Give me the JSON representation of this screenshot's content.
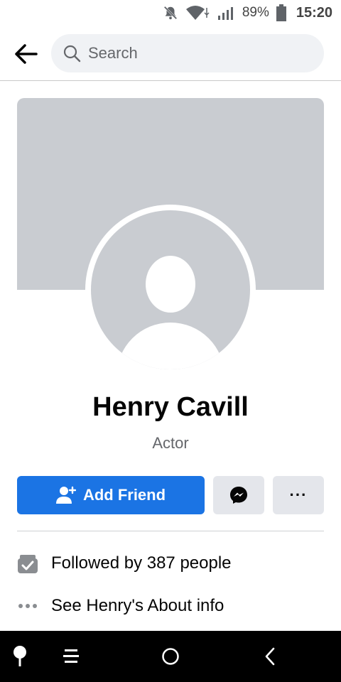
{
  "status_bar": {
    "icons": [
      "bell-muted-icon",
      "wifi-icon",
      "signal-icon",
      "battery-icon"
    ],
    "battery_percent": "89%",
    "time": "15:20"
  },
  "topbar": {
    "back_icon": "arrow-left-icon",
    "search": {
      "placeholder": "Search",
      "value": ""
    }
  },
  "profile": {
    "name": "Henry Cavill",
    "subtitle": "Actor"
  },
  "actions": {
    "add_friend_label": "Add Friend",
    "message_icon": "messenger-icon",
    "more_label": "···"
  },
  "info": [
    {
      "icon": "followers-icon",
      "text": "Followed by 387 people"
    },
    {
      "icon": "more-dots-icon",
      "text": "See Henry's About info"
    }
  ],
  "navbar": {
    "items": [
      "pin-icon",
      "menu-lines-icon",
      "home-circle-icon",
      "back-chevron-icon"
    ]
  },
  "colors": {
    "primary": "#1b74e4",
    "placeholder_gray": "#c9ccd1",
    "button_gray": "#e4e6eb",
    "search_bg": "#f0f2f5"
  }
}
